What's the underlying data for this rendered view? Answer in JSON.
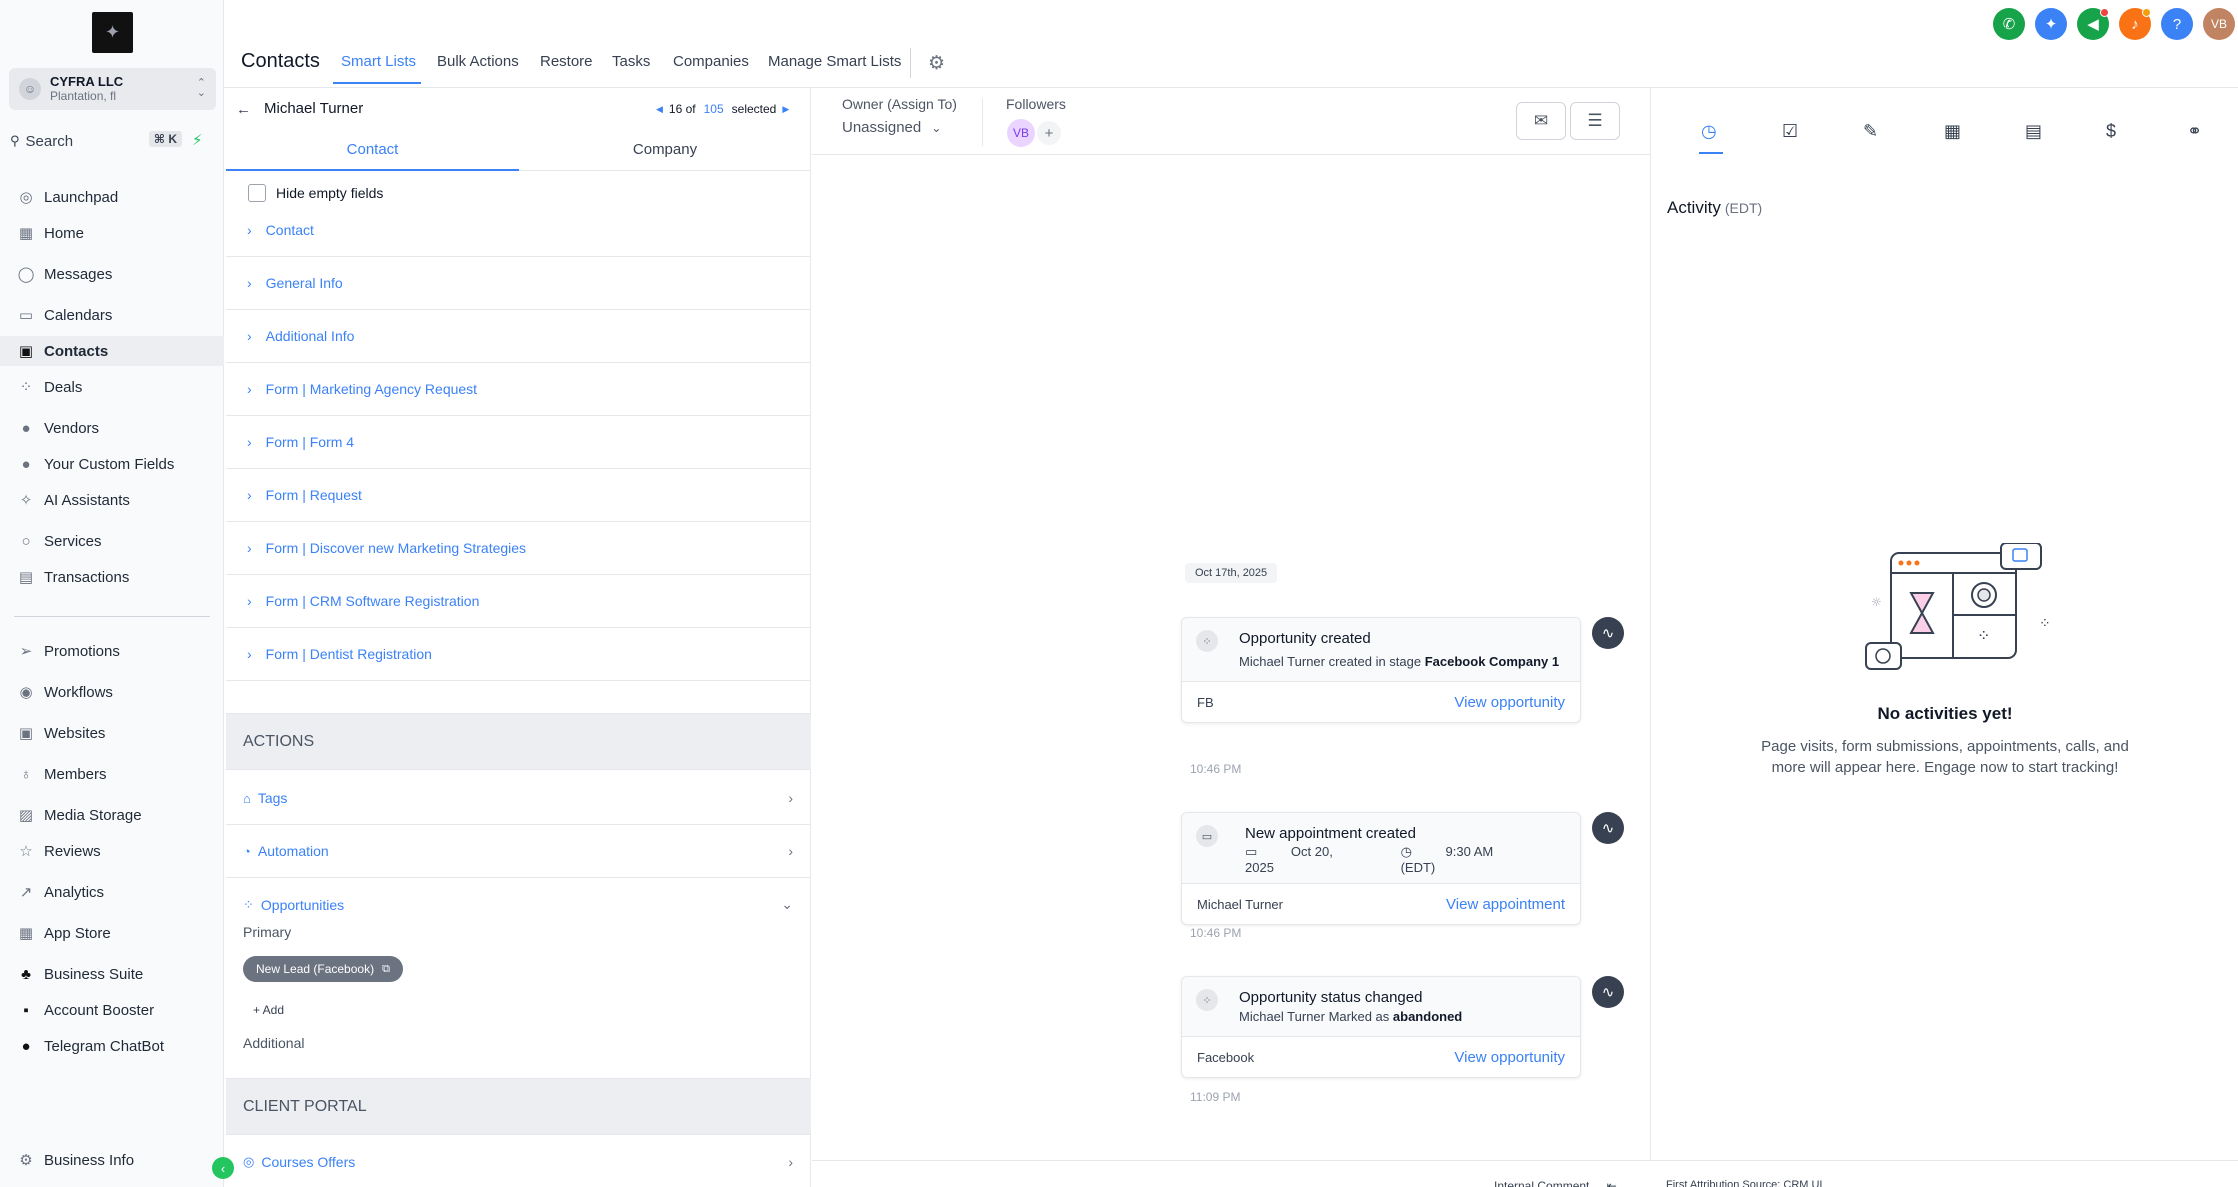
{
  "sidebar": {
    "account": {
      "name": "CYFRA LLC",
      "location": "Plantation, fl"
    },
    "search": {
      "label": "Search",
      "shortcut": "⌘ K"
    },
    "items": [
      {
        "label": "Launchpad",
        "icon": "rocket-icon"
      },
      {
        "label": "Home",
        "icon": "grid-icon"
      },
      {
        "label": "Messages",
        "icon": "chat-icon"
      },
      {
        "label": "Calendars",
        "icon": "calendar-icon"
      },
      {
        "label": "Contacts",
        "icon": "contacts-icon"
      },
      {
        "label": "Deals",
        "icon": "deals-icon"
      },
      {
        "label": "Vendors",
        "icon": "vendors-icon"
      },
      {
        "label": "Your Custom Fields",
        "icon": "custom-fields-icon"
      },
      {
        "label": "AI Assistants",
        "icon": "ai-icon"
      },
      {
        "label": "Services",
        "icon": "services-icon"
      },
      {
        "label": "Transactions",
        "icon": "transactions-icon"
      },
      {
        "label": "Promotions",
        "icon": "promotions-icon"
      },
      {
        "label": "Workflows",
        "icon": "workflows-icon"
      },
      {
        "label": "Websites",
        "icon": "websites-icon"
      },
      {
        "label": "Members",
        "icon": "members-icon"
      },
      {
        "label": "Media Storage",
        "icon": "media-icon"
      },
      {
        "label": "Reviews",
        "icon": "star-icon"
      },
      {
        "label": "Analytics",
        "icon": "analytics-icon"
      },
      {
        "label": "App Store",
        "icon": "app-store-icon"
      },
      {
        "label": "Business Suite",
        "icon": "business-suite-icon"
      },
      {
        "label": "Account Booster",
        "icon": "booster-icon"
      },
      {
        "label": "Telegram ChatBot",
        "icon": "telegram-icon"
      }
    ],
    "footer": {
      "label": "Business Info"
    }
  },
  "header": {
    "title": "Contacts",
    "tabs": [
      "Smart Lists",
      "Bulk Actions",
      "Restore",
      "Tasks",
      "Companies",
      "Manage Smart Lists"
    ],
    "user_initials": "VB"
  },
  "contact": {
    "name": "Michael Turner",
    "pager": {
      "current": "16 of",
      "total": "105",
      "suffix": "selected"
    },
    "tabs": [
      "Contact",
      "Company"
    ],
    "hide_empty_label": "Hide empty fields",
    "sections": [
      "Contact",
      "General Info",
      "Additional Info",
      "Form | Marketing Agency Request",
      "Form | Form 4",
      "Form | Request",
      "Form | Discover new Marketing Strategies",
      "Form | CRM Software Registration",
      "Form | Dentist Registration"
    ],
    "actions_header": "ACTIONS",
    "actions": [
      "Tags",
      "Automation",
      "Opportunities"
    ],
    "opportunities": {
      "primary_label": "Primary",
      "pill": "New Lead (Facebook)",
      "add_label": "+ Add",
      "additional_label": "Additional"
    },
    "client_portal_header": "CLIENT PORTAL",
    "client_portal_items": [
      "Courses Offers"
    ]
  },
  "conversation": {
    "owner_label": "Owner (Assign To)",
    "owner_value": "Unassigned",
    "followers_label": "Followers",
    "follower_initials": "VB",
    "date_chip": "Oct 17th, 2025",
    "cards": [
      {
        "title": "Opportunity created",
        "desc_prefix": "Michael Turner created in stage",
        "desc_bold": "Facebook Company 1",
        "footer_left": "FB",
        "link": "View opportunity",
        "time": "10:46 PM"
      },
      {
        "title": "New appointment created",
        "date": "Oct 20, 2025",
        "time_of_day": "9:30 AM (EDT)",
        "footer_left": "Michael Turner",
        "link": "View appointment",
        "time": "10:46 PM"
      },
      {
        "title": "Opportunity status changed",
        "desc_prefix": "Michael Turner Marked as",
        "desc_bold": "abandoned",
        "footer_left": "Facebook",
        "link": "View opportunity",
        "time": "11:09 PM"
      }
    ],
    "footer_comment": "Internal Comment",
    "footer_attribution": "First Attribution Source: CRM UI"
  },
  "activity": {
    "title": "Activity",
    "tz": "(EDT)",
    "empty_title": "No activities yet!",
    "empty_sub": "Page visits, form submissions, appointments, calls, and more will appear here. Engage now to start tracking!"
  },
  "colors": {
    "accent": "#3b82f6",
    "green": "#22c55e",
    "sidebar_bg": "#f9fafb"
  }
}
